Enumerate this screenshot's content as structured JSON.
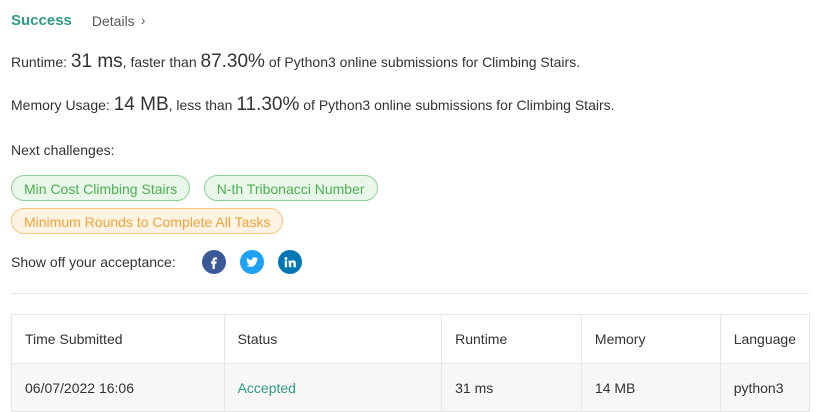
{
  "header": {
    "status": "Success",
    "details_label": "Details",
    "details_icon": "chevron-right-icon"
  },
  "runtime": {
    "label": "Runtime:",
    "value": "31 ms",
    "mid": ", faster than",
    "percent": "87.30%",
    "suffix": "of Python3 online submissions for Climbing Stairs."
  },
  "memory": {
    "label": "Memory Usage:",
    "value": "14 MB",
    "mid": ", less than",
    "percent": "11.30%",
    "suffix": "of Python3 online submissions for Climbing Stairs."
  },
  "next": {
    "label": "Next challenges:",
    "challenges": [
      {
        "label": "Min Cost Climbing Stairs",
        "color": "green"
      },
      {
        "label": "N-th Tribonacci Number",
        "color": "green"
      },
      {
        "label": "Minimum Rounds to Complete All Tasks",
        "color": "orange"
      }
    ]
  },
  "share": {
    "label": "Show off your acceptance:",
    "icons": [
      "facebook-icon",
      "twitter-icon",
      "linkedin-icon"
    ]
  },
  "table": {
    "headers": [
      "Time Submitted",
      "Status",
      "Runtime",
      "Memory",
      "Language"
    ],
    "rows": [
      [
        "06/07/2022 16:06",
        "Accepted",
        "31 ms",
        "14 MB",
        "python3"
      ]
    ]
  },
  "colors": {
    "success": "#2e9a86",
    "tag_green_bg": "#e9f6ea",
    "tag_green_text": "#4caf50",
    "tag_orange_bg": "#fff4e3",
    "tag_orange_text": "#f0a23b",
    "facebook": "#3b5998",
    "twitter": "#1da1f2",
    "linkedin": "#0077b5"
  }
}
